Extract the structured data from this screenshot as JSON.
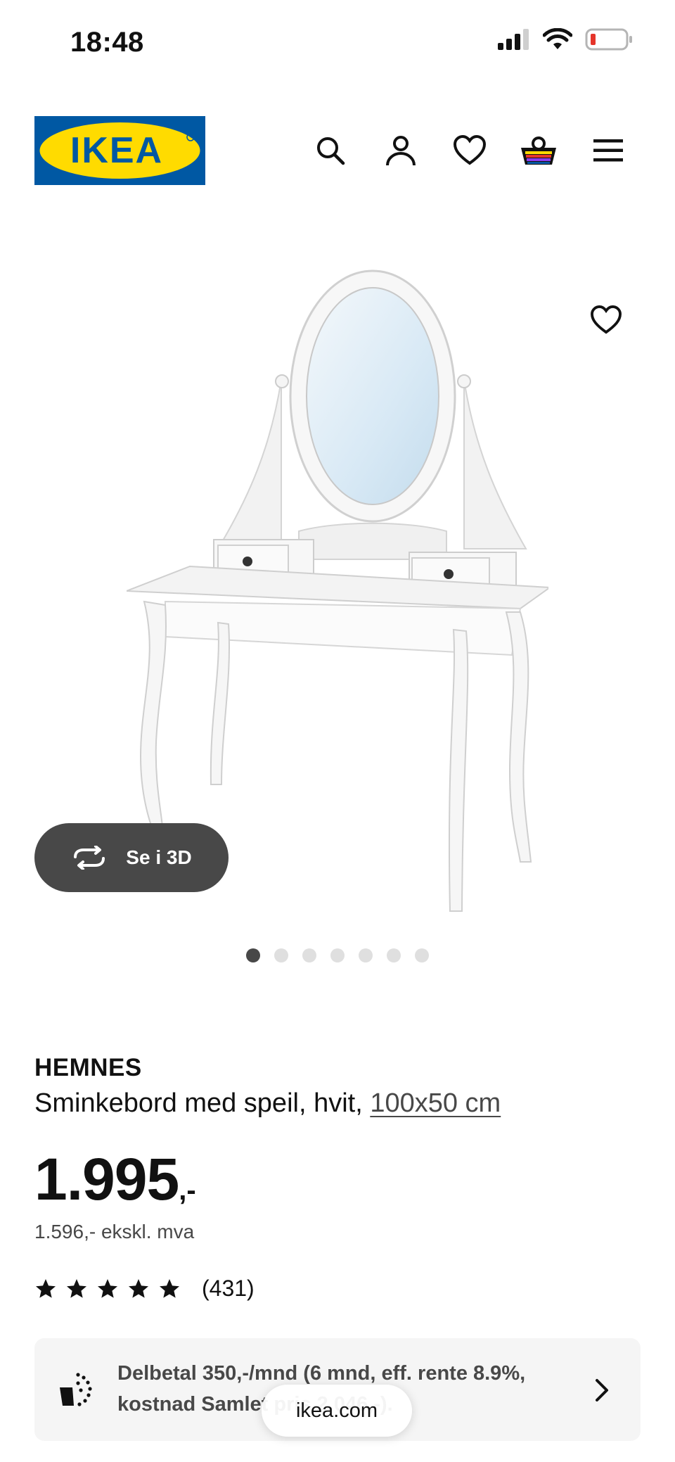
{
  "status_bar": {
    "time": "18:48",
    "icons": [
      "signal-icon",
      "wifi-icon",
      "battery-icon"
    ]
  },
  "header": {
    "logo_text": "IKEA",
    "icons": [
      "search-icon",
      "account-icon",
      "heart-icon",
      "cart-icon",
      "menu-icon"
    ],
    "colors": {
      "logo_blue": "#0058a3",
      "logo_yellow": "#ffdb00"
    }
  },
  "gallery": {
    "view_3d_label": "Se i 3D",
    "dot_count": 7,
    "active_dot": 0
  },
  "product": {
    "brand": "HEMNES",
    "description": "Sminkebord med speil, hvit, ",
    "dimension_link": "100x50 cm",
    "price_integer": "1.995",
    "price_suffix": ",-",
    "price_ex_vat": "1.596,- ekskl. mva",
    "rating_stars": 5,
    "rating_count": "(431)"
  },
  "financing": {
    "text": "Delbetal 350,-/mnd (6 mnd, eff. rente 8.9%, kostnad Samlet pris 2.046,-)."
  },
  "browser": {
    "url": "ikea.com"
  }
}
